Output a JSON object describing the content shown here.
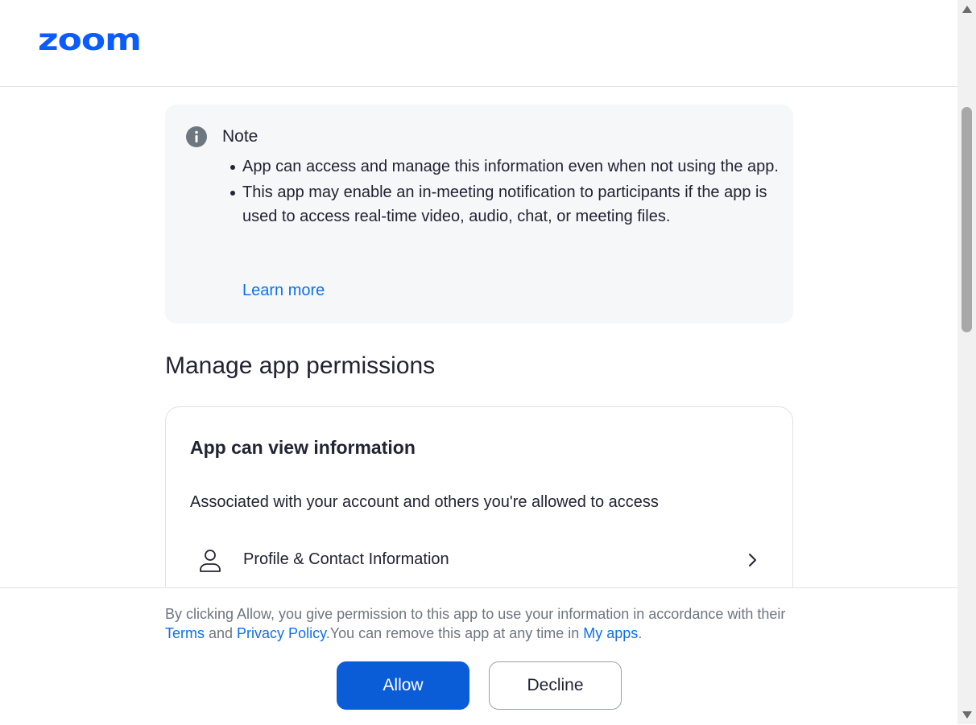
{
  "header": {
    "logo_text": "zoom",
    "brand_color": "#0b5cff"
  },
  "note": {
    "icon": "info-icon",
    "title": "Note",
    "items": [
      "App can access and manage this information even when not using the app.",
      "This app may enable an in-meeting notification to participants if the app is used to access real-time video, audio, chat, or meeting files."
    ],
    "learn_more": "Learn more"
  },
  "permissions": {
    "title": "Manage app permissions",
    "card": {
      "title": "App can view information",
      "description": "Associated with your account and others you're allowed to access",
      "rows": [
        {
          "icon": "user-icon",
          "label": "Profile & Contact Information"
        }
      ]
    }
  },
  "footer": {
    "consent_prefix": "By clicking Allow, you give permission to this app to use your information in accordance with their ",
    "terms_link": "Terms",
    "and_text": " and ",
    "privacy_link": "Privacy Policy",
    "consent_middle": ".You can remove this app at any time in ",
    "my_apps_link": "My apps",
    "consent_suffix": ".",
    "allow_label": "Allow",
    "decline_label": "Decline"
  },
  "colors": {
    "link": "#0e71eb",
    "primary_button": "#0b5cd7",
    "note_bg": "#f6f7f9"
  }
}
